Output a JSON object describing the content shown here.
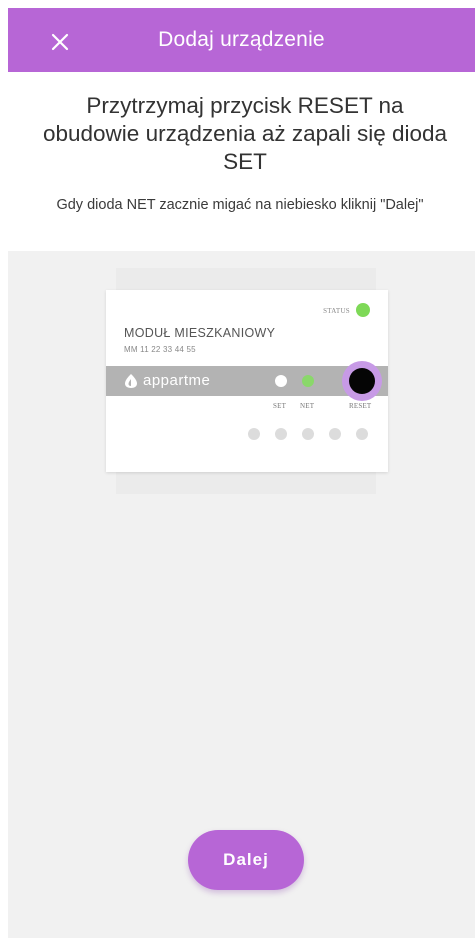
{
  "header": {
    "title": "Dodaj urządzenie",
    "close_icon": "close-icon"
  },
  "instruction": "Przytrzymaj przycisk RESET na obudowie urządzenia aż zapali się dioda SET",
  "hint": "Gdy dioda NET zacznie migać na niebiesko kliknij \"Dalej\"",
  "device": {
    "status_label": "STATUS",
    "module_name": "MODUŁ MIESZKANIOWY",
    "serial": "MM 11 22 33 44 55",
    "brand": "appartme",
    "led_labels": {
      "set": "SET",
      "net": "NET",
      "reset": "RESET"
    },
    "colors": {
      "status_led": "#7ed957",
      "net_led": "#8ad86a",
      "set_led": "#ffffff",
      "reset_button": "#050505",
      "reset_highlight": "#c79ae6"
    }
  },
  "next_button": {
    "label": "Dalej"
  },
  "theme": {
    "accent": "#b766d6"
  }
}
